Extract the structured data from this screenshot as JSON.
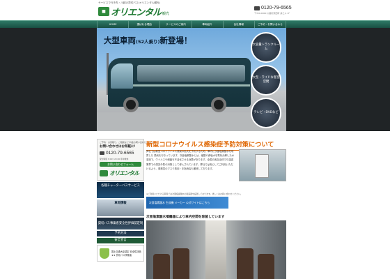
{
  "header": {
    "tagline": "サービスで行き先・川越の貸切バス(オリエンタル観光)",
    "brand": "オリエンタル",
    "brand_sub": "観光",
    "logo_badge": "bus",
    "phone": "0120-79-6565",
    "address": "〒350-0000 川越市東田町 某ビル 1F"
  },
  "nav": {
    "items": [
      "HOME",
      "選ばれる理由",
      "サービスのご案内",
      "車両紹介",
      "会社情報",
      "ご予約・お問い合わせ"
    ]
  },
  "hero": {
    "headline": "大型車両",
    "headline_small": "(52人乗り)",
    "headline_tail": "新登場！",
    "badges": [
      "大容量トランクルーム",
      "大型・ワイドな客室空間",
      "テレビ・DVDなど"
    ]
  },
  "sidebar": {
    "contact_lead": "ご予約・お見積り、ご相談など 料金お問い合わせください",
    "contact_title": "お問い合わせはお気軽に!",
    "phone": "0120-79-6565",
    "hours": "受付時間 8:00～20:00 年中無休",
    "form_button": "お問い合わせフォーム",
    "logo_brand": "オリエンタル",
    "banners": {
      "charter": "各種チャーターバスサービス",
      "fleet": "車両情報",
      "safety_top": "貸切バス事業者安全性評価認定制度",
      "reserve": "予約方法",
      "declare": "安全宣言",
      "shield_text": "国土交通大臣認定 安全性評価 ★★ 貸切バス事業者"
    }
  },
  "main": {
    "title": "新型コロナウイルス感染症予防対策について",
    "paragraph": "弊社では新型コロナウイルス感染の拡大を予防するため、車内に次亜塩素酸水を噴霧した 換気を行なっています。次亜塩素酸水とは、塩酸や食塩水を電気分解した水溶液で、ウイルスや細菌を不活化させる効果があります。全国の各自治体でも運送業界での感染予防の対策として導入されています。弊社では安心してご利用いただけるよう、乗務員のマスク着用・手指消毒も徹底しております。",
    "note": "※ご利用いただける車両では次亜塩素酸水の噴霧器を設置しております。詳しくはお問い合わせください。",
    "banner_text": "次亜塩素酸水 生成機 メーカー 公式サイトはこちら",
    "subtitle": "次亜塩素酸水噴霧器により車内空間を除菌しています"
  },
  "colors": {
    "brand_green": "#1f7a33",
    "nav_teal": "#1f5c4d",
    "title_orange": "#e06a08"
  }
}
